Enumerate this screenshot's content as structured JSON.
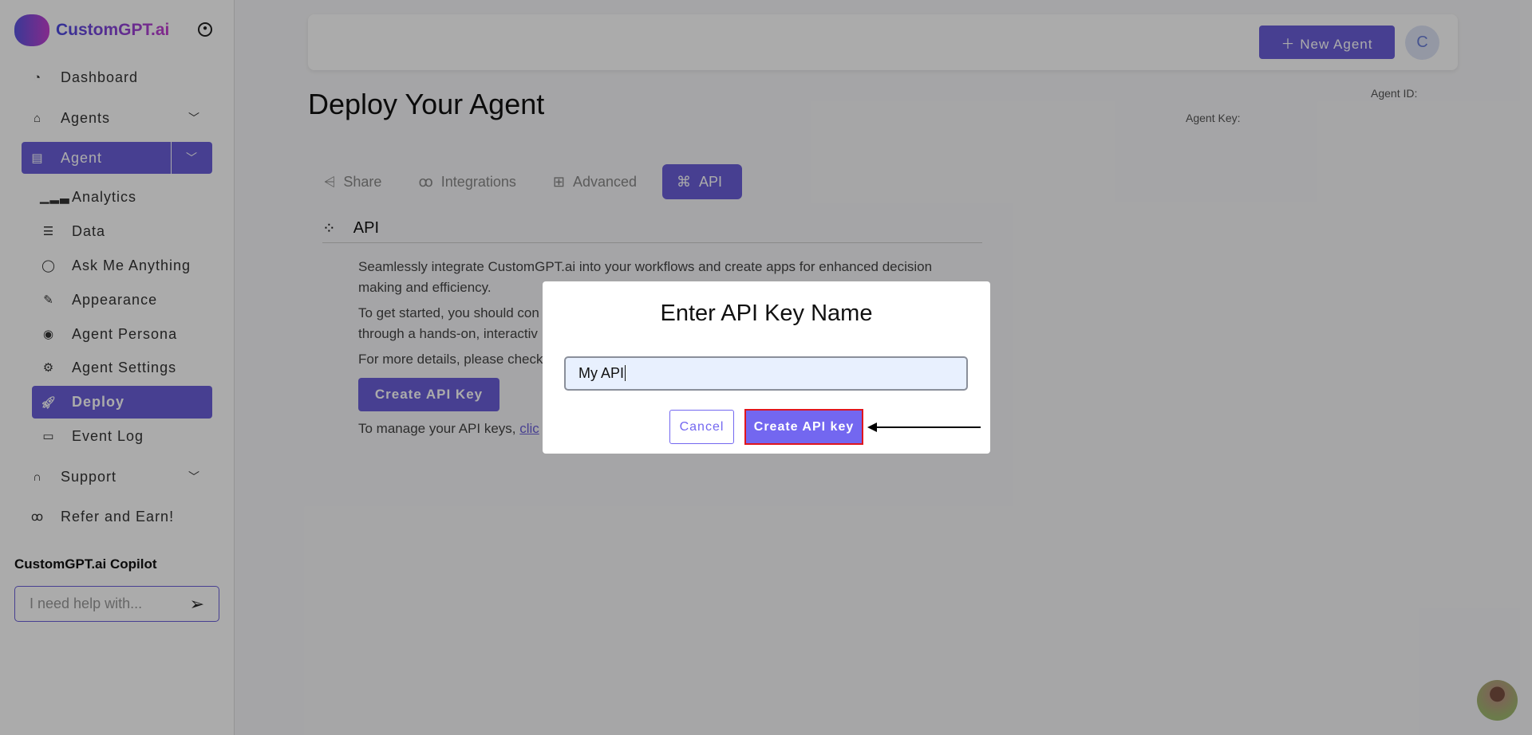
{
  "brand": {
    "name": "CustomGPT.ai"
  },
  "sidebar": {
    "items": [
      {
        "label": "Dashboard",
        "icon": "gauge-icon"
      },
      {
        "label": "Agents",
        "icon": "inbox-icon"
      },
      {
        "label": "Agent",
        "icon": "clipboard-icon"
      },
      {
        "label": "Analytics",
        "icon": "bar-chart-icon"
      },
      {
        "label": "Data",
        "icon": "database-icon"
      },
      {
        "label": "Ask Me Anything",
        "icon": "chat-icon"
      },
      {
        "label": "Appearance",
        "icon": "brush-icon"
      },
      {
        "label": "Agent Persona",
        "icon": "user-circle-icon"
      },
      {
        "label": "Agent Settings",
        "icon": "gear-icon"
      },
      {
        "label": "Deploy",
        "icon": "rocket-icon"
      },
      {
        "label": "Event Log",
        "icon": "archive-icon"
      },
      {
        "label": "Support",
        "icon": "headphones-icon"
      },
      {
        "label": "Refer and Earn!",
        "icon": "share-nodes-icon"
      }
    ],
    "copilot": {
      "title": "CustomGPT.ai Copilot",
      "placeholder": "I need help with..."
    }
  },
  "header": {
    "new_agent": "New Agent",
    "avatar_initial": "C"
  },
  "page": {
    "title": "Deploy Your Agent",
    "agent_id_label": "Agent ID:",
    "agent_key_label": "Agent Key:"
  },
  "tabs": [
    {
      "label": "Share"
    },
    {
      "label": "Integrations"
    },
    {
      "label": "Advanced"
    },
    {
      "label": "API",
      "active": true
    }
  ],
  "api": {
    "heading": "API",
    "p1a": "Seamlessly integrate CustomGPT.ai into your workflows and create apps for enhanced decision",
    "p1b": "making and efficiency.",
    "p2a": "To get started, you should con",
    "p2b": "through a hands-on, interactiv",
    "p3": "For more details, please check",
    "create_button": "Create API Key",
    "manage_text": "To manage your API keys, ",
    "manage_link": "clic"
  },
  "modal": {
    "title": "Enter API Key Name",
    "input_value": "My API",
    "cancel": "Cancel",
    "confirm": "Create API key"
  },
  "colors": {
    "accent": "#7367f0",
    "highlight": "#e0161e"
  }
}
